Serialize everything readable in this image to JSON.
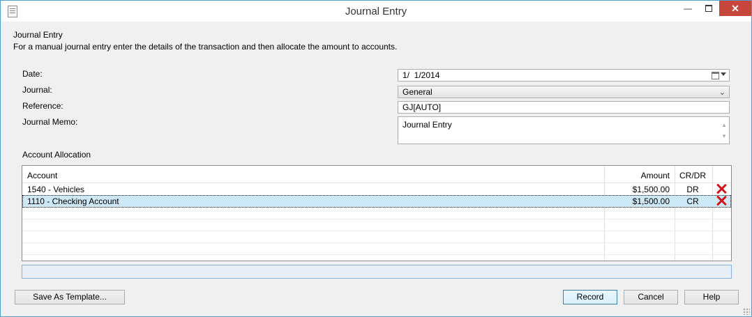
{
  "window": {
    "title": "Journal Entry"
  },
  "header": {
    "heading": "Journal Entry",
    "description": "For a manual journal entry enter the details of the transaction and then allocate the amount to accounts."
  },
  "form": {
    "date_label": "Date:",
    "date_value": "1/  1/2014",
    "journal_label": "Journal:",
    "journal_value": "General",
    "reference_label": "Reference:",
    "reference_value": "GJ[AUTO]",
    "memo_label": "Journal Memo:",
    "memo_value": "Journal Entry"
  },
  "allocation": {
    "section_label": "Account Allocation",
    "columns": {
      "account": "Account",
      "amount": "Amount",
      "crdr": "CR/DR"
    },
    "rows": [
      {
        "account": "1540 - Vehicles",
        "amount": "$1,500.00",
        "crdr": "DR",
        "selected": false
      },
      {
        "account": "1110 - Checking Account",
        "amount": "$1,500.00",
        "crdr": "CR",
        "selected": true
      }
    ]
  },
  "buttons": {
    "save_template": "Save As Template...",
    "record": "Record",
    "cancel": "Cancel",
    "help": "Help"
  },
  "icons": {
    "app": "document-icon",
    "delete": "delete-x-icon",
    "calendar": "calendar-icon"
  },
  "colors": {
    "accent": "#4f9fd4",
    "close": "#c7463b",
    "delete": "#d0121a",
    "selection": "#cde8f7"
  }
}
